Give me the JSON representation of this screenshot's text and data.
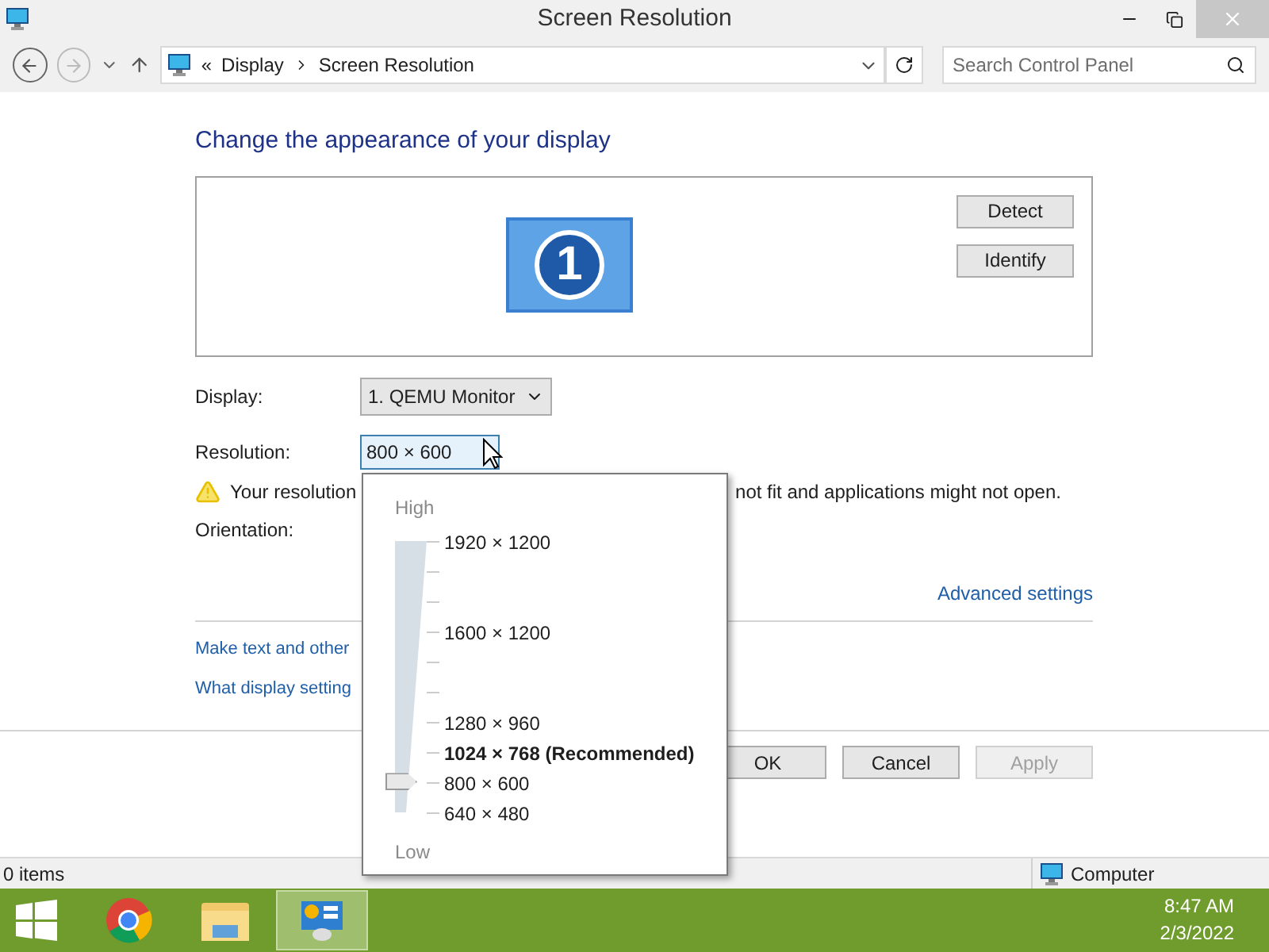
{
  "window": {
    "title": "Screen Resolution"
  },
  "address_bar": {
    "overflow": "«",
    "crumbs": [
      "Display",
      "Screen Resolution"
    ]
  },
  "search": {
    "placeholder": "Search Control Panel"
  },
  "heading": "Change the appearance of your display",
  "monitor_number": "1",
  "side_buttons": [
    "Detect",
    "Identify"
  ],
  "display": {
    "label": "Display:",
    "value": "1. QEMU Monitor"
  },
  "resolution": {
    "label": "Resolution:",
    "value": "800 × 600"
  },
  "warning": {
    "text_start": "Your resolution",
    "text_end": "not fit and applications might not open."
  },
  "orientation": {
    "label": "Orientation:"
  },
  "advanced_link": "Advanced settings",
  "links": [
    "Make text and other",
    "What display setting"
  ],
  "buttons": [
    {
      "label": "OK",
      "disabled": false
    },
    {
      "label": "Cancel",
      "disabled": false
    },
    {
      "label": "Apply",
      "disabled": true
    }
  ],
  "status_bar": {
    "items": "0 items",
    "location": "Computer"
  },
  "resolution_popup": {
    "high": "High",
    "low": "Low",
    "level": 0.11,
    "options": [
      {
        "label": "1920 × 1200",
        "kind": "normal"
      },
      {
        "label": "1600 × 1200",
        "kind": "normal"
      },
      {
        "label": "1280 × 960",
        "kind": "normal"
      },
      {
        "label": "1024 × 768 (Recommended)",
        "kind": "recommended"
      },
      {
        "label": "800 × 600",
        "kind": "normal"
      },
      {
        "label": "640 × 480",
        "kind": "normal"
      }
    ]
  },
  "taskbar": {
    "time": "8:47 AM",
    "date": "2/3/2022"
  }
}
